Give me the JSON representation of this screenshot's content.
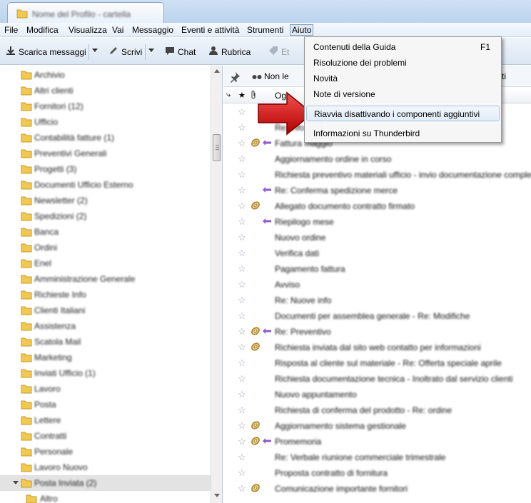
{
  "tab": {
    "title": "Nome del Profilo - cartella"
  },
  "menubar": {
    "items": [
      "File",
      "Modifica",
      "Visualizza",
      "Vai",
      "Messaggio",
      "Eventi e attività",
      "Strumenti",
      "Aiuto"
    ]
  },
  "toolbar": {
    "get_messages": "Scarica messaggi",
    "write": "Scrivi",
    "chat": "Chat",
    "address_book": "Rubrica",
    "tag": "Et"
  },
  "quick_filter": {
    "unread": "Non le",
    "contacts": "ti"
  },
  "thread_columns": {
    "subject": "Og"
  },
  "help_menu": {
    "items": [
      {
        "label": "Contenuti della Guida",
        "shortcut": "F1"
      },
      {
        "label": "Risoluzione dei problemi",
        "shortcut": ""
      },
      {
        "label": "Novità",
        "shortcut": ""
      },
      {
        "label": "Note di versione",
        "shortcut": ""
      },
      {
        "label": "Riavvia disattivando i componenti aggiuntivi",
        "shortcut": ""
      },
      {
        "label": "Informazioni su Thunderbird",
        "shortcut": ""
      }
    ]
  },
  "folders": [
    "Archivio",
    "Altri clienti",
    "Fornitori (12)",
    "Ufficio",
    "Contabilità fatture (1)",
    "Preventivi Generali",
    "Progetti (3)",
    "Documenti Ufficio Esterno",
    "Newsletter (2)",
    "Spedizioni (2)",
    "Banca",
    "Ordini",
    "Enel",
    "Amministrazione Generale",
    "Richieste Info",
    "Clienti Italiani",
    "Assistenza",
    "Scatola Mail",
    "Marketing",
    "Inviati Ufficio (1)",
    "Lavoro",
    "Posta",
    "Lettere",
    "Contratti",
    "Personale",
    "Lavoro Nuovo",
    "Posta Inviata (2)",
    "Altro"
  ],
  "messages": [
    {
      "subject": "Re: richiesta",
      "clip": false,
      "reply": false
    },
    {
      "subject": "Re: info",
      "clip": false,
      "reply": false
    },
    {
      "subject": "Fattura maggio",
      "clip": true,
      "reply": true
    },
    {
      "subject": "Aggiornamento ordine in corso",
      "clip": false,
      "reply": false
    },
    {
      "subject": "Richiesta preventivo materiali ufficio - invio documentazione completa",
      "clip": false,
      "reply": false
    },
    {
      "subject": "Re: Conferma spedizione merce",
      "clip": false,
      "reply": true
    },
    {
      "subject": "Allegato documento contratto firmato",
      "clip": true,
      "reply": false
    },
    {
      "subject": "Riepilogo mese",
      "clip": false,
      "reply": true
    },
    {
      "subject": "Nuovo ordine",
      "clip": false,
      "reply": false
    },
    {
      "subject": "Verifica dati",
      "clip": false,
      "reply": false
    },
    {
      "subject": "Pagamento fattura",
      "clip": false,
      "reply": false
    },
    {
      "subject": "Avviso",
      "clip": false,
      "reply": false
    },
    {
      "subject": "Re: Nuove info",
      "clip": false,
      "reply": false
    },
    {
      "subject": "Documenti per assemblea generale - Re: Modifiche",
      "clip": false,
      "reply": false
    },
    {
      "subject": "Re: Preventivo",
      "clip": true,
      "reply": true
    },
    {
      "subject": "Richiesta inviata dal sito web contatto per informazioni",
      "clip": true,
      "reply": false
    },
    {
      "subject": "Risposta al cliente sul materiale - Re: Offerta speciale aprile",
      "clip": false,
      "reply": false
    },
    {
      "subject": "Richiesta documentazione tecnica - Inoltrato dal servizio clienti",
      "clip": false,
      "reply": false
    },
    {
      "subject": "Nuovo appuntamento",
      "clip": false,
      "reply": false
    },
    {
      "subject": "Richiesta di conferma del prodotto - Re: ordine",
      "clip": false,
      "reply": false
    },
    {
      "subject": "Aggiornamento sistema gestionale",
      "clip": true,
      "reply": false
    },
    {
      "subject": "Promemoria",
      "clip": true,
      "reply": true
    },
    {
      "subject": "Re: Verbale riunione commerciale trimestrale",
      "clip": false,
      "reply": false
    },
    {
      "subject": "Proposta contratto di fornitura",
      "clip": false,
      "reply": false
    },
    {
      "subject": "Comunicazione importante fornitori",
      "clip": true,
      "reply": false
    }
  ],
  "colors": {
    "menu_highlight_border": "#a8c5ea",
    "arrow_red": "#d41a1a",
    "attachment_gold": "#b58a2a",
    "reply_purple": "#8e5bd0",
    "folder_yellow": "#f2c94c"
  }
}
